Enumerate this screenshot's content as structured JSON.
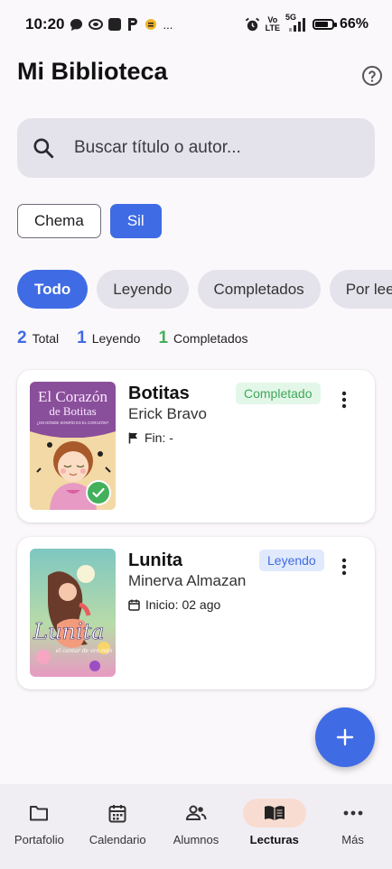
{
  "status_bar": {
    "time": "10:20",
    "extra": "...",
    "net_top": "Vo",
    "net_bottom": "LTE",
    "net_gen": "5G",
    "battery_pct": "66%",
    "battery_level": 0.66
  },
  "header": {
    "title": "Mi Biblioteca",
    "help_icon": "help-circle-icon"
  },
  "search": {
    "placeholder": "Buscar título o autor...",
    "value": ""
  },
  "users": [
    {
      "label": "Chema",
      "selected": false
    },
    {
      "label": "Sil",
      "selected": true
    }
  ],
  "filters": [
    {
      "label": "Todo",
      "active": true
    },
    {
      "label": "Leyendo",
      "active": false
    },
    {
      "label": "Completados",
      "active": false
    },
    {
      "label": "Por leer",
      "active": false
    }
  ],
  "stats": {
    "total_num": "2",
    "total_label": "Total",
    "reading_num": "1",
    "reading_label": "Leyendo",
    "done_num": "1",
    "done_label": "Completados"
  },
  "books": [
    {
      "title": "Botitas",
      "author": "Erick Bravo",
      "status": "Completado",
      "meta": "Fin: -",
      "cover_title_line1": "El Corazón",
      "cover_title_line2": "de Botitas",
      "cover_subtitle": "¿EN DÓNDE SONRÍO ES EL CORAZÓN?"
    },
    {
      "title": "Lunita",
      "author": "Minerva Almazan",
      "status": "Leyendo",
      "meta": "Inicio: 02 ago",
      "cover_title": "Lunita",
      "cover_subtitle": "el cantar de oro rojo"
    }
  ],
  "fab_icon": "plus-icon",
  "nav": [
    {
      "label": "Portafolio",
      "icon": "folder-icon",
      "active": false
    },
    {
      "label": "Calendario",
      "icon": "calendar-icon",
      "active": false
    },
    {
      "label": "Alumnos",
      "icon": "people-icon",
      "active": false
    },
    {
      "label": "Lecturas",
      "icon": "open-book-icon",
      "active": true
    },
    {
      "label": "Más",
      "icon": "more-horizontal-icon",
      "active": false
    }
  ],
  "colors": {
    "accent": "#3f6be4",
    "completed": "#43b05c",
    "background": "#fbf8fc",
    "active_nav_pill": "#f8dcd2"
  }
}
